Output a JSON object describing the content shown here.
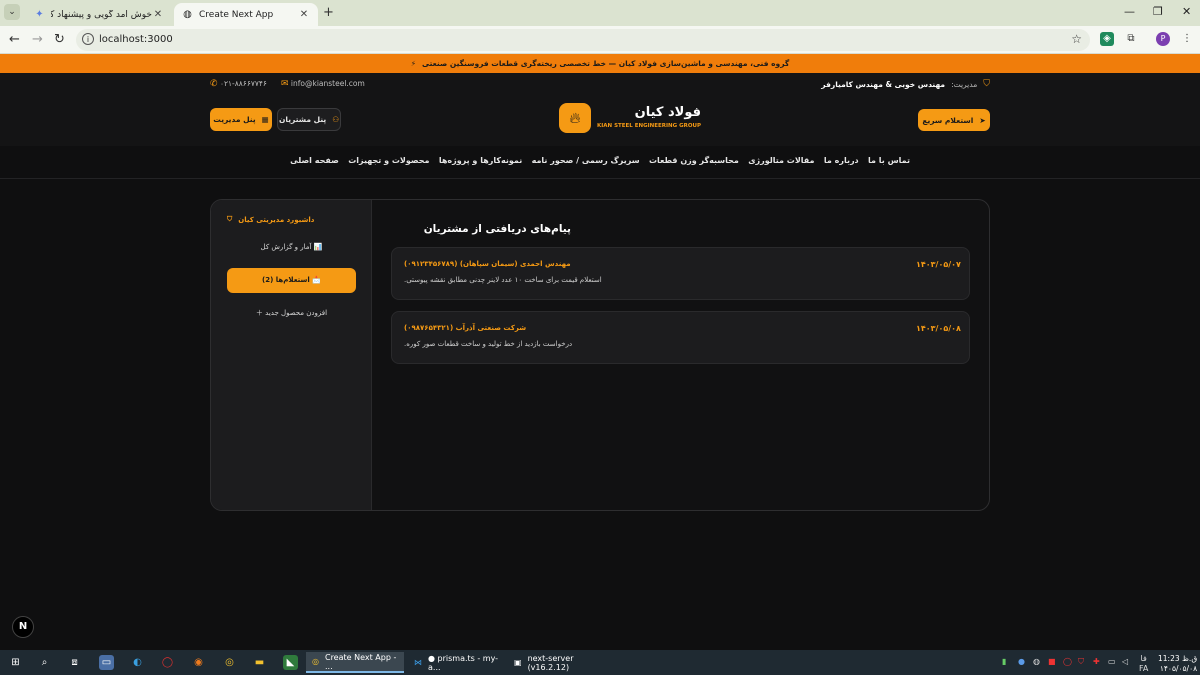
{
  "browser": {
    "tabs": [
      {
        "title": "خوش آمد گویی و پیشنهاد کمک -",
        "active": false
      },
      {
        "title": "Create Next App",
        "active": true
      }
    ],
    "url": "localhost:3000",
    "profile_initial": "P"
  },
  "site": {
    "promo": "گروه فنی، مهندسی و ماشین‌سازی فولاد کیان — خط تخصصی ریخته‌گری قطعات فروسنگین صنعتی",
    "management_label": "مدیریت:",
    "management_names": "مهندس خوبی & مهندس کامیارفر",
    "email": "info@kiansteel.com",
    "phone": "۰۲۱-۸۸۶۶۷۷۴۶",
    "quick_inquiry": "استعلام سریع",
    "admin_panel": "پنل مدیریت",
    "customer_panel": "پنل مشتریان",
    "logo_title": "فولاد کیان",
    "logo_subtitle": "KIAN STEEL ENGINEERING GROUP",
    "nav": [
      "تماس با ما",
      "درباره ما",
      "مقالات متالورژی",
      "محاسبه‌گر وزن قطعات",
      "سریرگ رسمی / صحور نامه",
      "نمونه‌کارها و پروژه‌ها",
      "محصولات و تجهیزات",
      "صفحه اصلی"
    ]
  },
  "dashboard": {
    "title": "داشبورد مدیریتی کیان",
    "menu": {
      "stats": "آمار و گزارش کل 📊",
      "inquiries": "استعلام‌ها (2) 📩",
      "add_product": "افزودن محصول جدید"
    },
    "content_title": "پیام‌های دریافتی از مشتریان",
    "messages": [
      {
        "sender": "مهندس احمدی (سیمان سپاهان) (۰۹۱۲۳۴۵۶۷۸۹)",
        "date": "۱۴۰۳/۰۵/۰۷",
        "text": "استعلام قیمت برای ساخت ۱۰ عدد لاینر چدنی مطابق نقشه پیوستی."
      },
      {
        "sender": "شرکت صنعتی آذرآب (۰۹۸۷۶۵۴۳۲۱)",
        "date": "۱۴۰۳/۰۵/۰۸",
        "text": "درخواست بازدید از خط تولید و ساخت قطعات صور کوره."
      }
    ]
  },
  "taskbar": {
    "apps": [
      {
        "label": "Create Next App - ...",
        "icon": "chrome-icon",
        "active": true
      },
      {
        "label": "● prisma.ts - my-a...",
        "icon": "vscode-icon",
        "active": false
      },
      {
        "label": "next-server (v16.2.12)",
        "icon": "terminal-icon",
        "active": false
      }
    ],
    "time": "11:23 ق.ظ",
    "date": "۱۴۰۵/۰۵/۰۸",
    "lang": "FA",
    "lang2": "فا"
  },
  "colors": {
    "accent": "#f59a14",
    "promo": "#f07d0b",
    "bg": "#0f0f10"
  }
}
